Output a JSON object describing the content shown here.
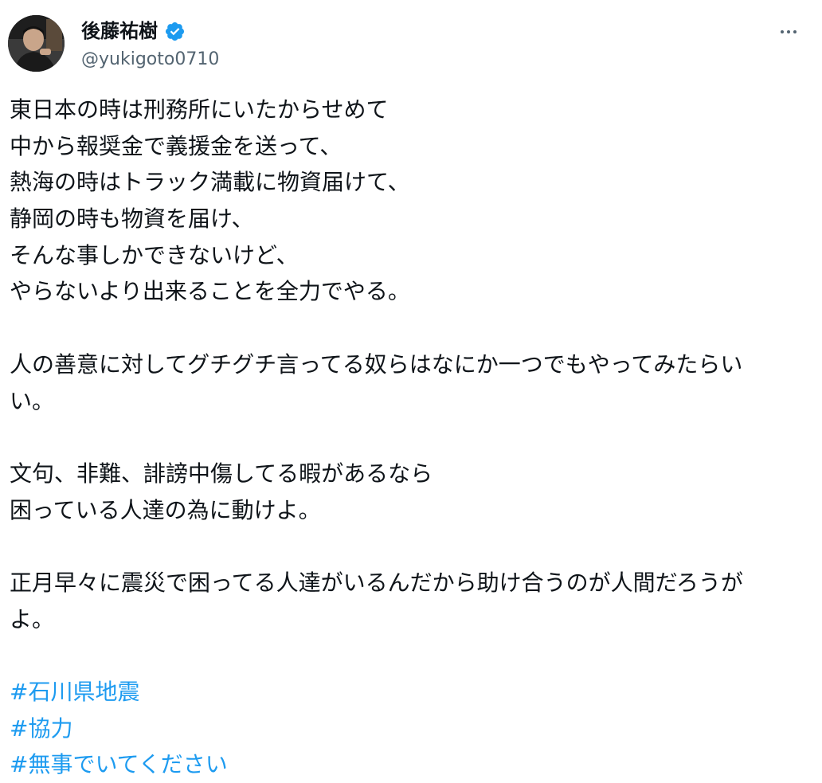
{
  "author": {
    "display_name": "後藤祐樹",
    "handle": "@yukigoto0710",
    "verified_icon": "verified-badge-icon"
  },
  "menu": {
    "more_icon": "more-dots-icon"
  },
  "tweet": {
    "paragraph_1": [
      "東日本の時は刑務所にいたからせめて",
      "中から報奨金で義援金を送って、",
      "熱海の時はトラック満載に物資届けて、",
      "静岡の時も物資を届け、",
      "そんな事しかできないけど、",
      "やらないより出来ることを全力でやる。"
    ],
    "paragraph_2": [
      "人の善意に対してグチグチ言ってる奴らはなにか一つでもやってみたらい",
      "い。"
    ],
    "paragraph_3": [
      "文句、非難、誹謗中傷してる暇があるなら",
      "困っている人達の為に動けよ。"
    ],
    "paragraph_4": [
      "正月早々に震災で困ってる人達がいるんだから助け合うのが人間だろうが",
      "よ。"
    ],
    "hashtags": [
      "#石川県地震",
      "#協力",
      "#無事でいてください"
    ]
  },
  "colors": {
    "text": "#0f1419",
    "secondary": "#536471",
    "accent": "#1d9bf0"
  }
}
